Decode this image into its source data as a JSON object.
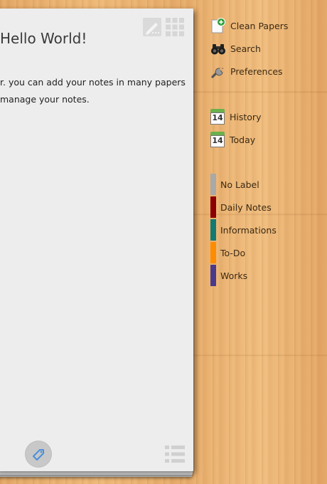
{
  "paper": {
    "title": "Hello World!",
    "body_lines": [
      "r. you can add your notes in many papers",
      "manage your notes."
    ]
  },
  "sidebar": {
    "actions": [
      {
        "label": "Clean Papers",
        "icon": "clean-papers-icon"
      },
      {
        "label": "Search",
        "icon": "binoculars-icon"
      },
      {
        "label": "Preferences",
        "icon": "wrench-icon"
      }
    ],
    "dates": [
      {
        "label": "History",
        "icon": "calendar-icon",
        "day": "14"
      },
      {
        "label": "Today",
        "icon": "calendar-icon",
        "day": "14"
      }
    ],
    "labels": [
      {
        "label": "No Label",
        "color": "#a9a9a9"
      },
      {
        "label": "Daily Notes",
        "color": "#8b0000"
      },
      {
        "label": "Informations",
        "color": "#127a72"
      },
      {
        "label": "To-Do",
        "color": "#ff8c00"
      },
      {
        "label": "Works",
        "color": "#4b3a8c"
      }
    ]
  }
}
